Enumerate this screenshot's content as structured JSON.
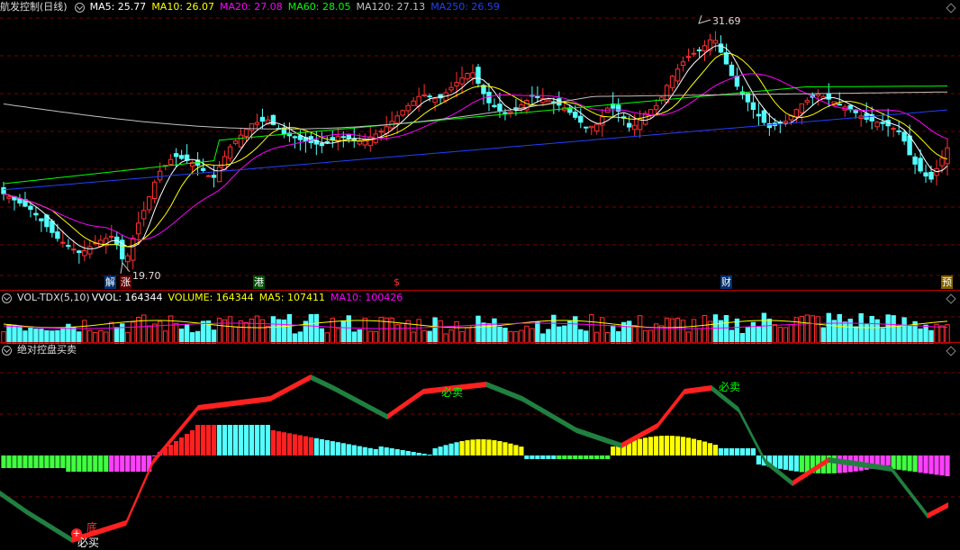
{
  "main_panel": {
    "title": "航发控制(日线)",
    "ma_labels": [
      {
        "text": "MA5: 25.77",
        "color": "#ffffff"
      },
      {
        "text": "MA10: 26.07",
        "color": "#ffff00"
      },
      {
        "text": "MA20: 27.08",
        "color": "#ff00ff"
      },
      {
        "text": "MA60: 28.05",
        "color": "#00ff00"
      },
      {
        "text": "MA120: 27.13",
        "color": "#c0c0c0"
      },
      {
        "text": "MA250: 26.59",
        "color": "#2040ff"
      }
    ],
    "high_label": "31.69",
    "low_label": "19.70",
    "event_marks": [
      {
        "text": "解",
        "bg": "#003070",
        "fg": "#ffffff"
      },
      {
        "text": "涨",
        "bg": "#5a0000",
        "fg": "#ffffff"
      },
      {
        "text": "港",
        "bg": "#005000",
        "fg": "#ffffff"
      },
      {
        "text": "$",
        "bg": "#000000",
        "fg": "#ff3030"
      },
      {
        "text": "财",
        "bg": "#003070",
        "fg": "#ffffff"
      },
      {
        "text": "预",
        "bg": "#806000",
        "fg": "#ffffff"
      }
    ]
  },
  "volume_panel": {
    "title": "VOL-TDX(5,10)",
    "labels": [
      {
        "text": "VVOL: 164344",
        "color": "#ffffff"
      },
      {
        "text": "VOLUME: 164344",
        "color": "#ffff00"
      },
      {
        "text": "MA5: 107411",
        "color": "#ffff00"
      },
      {
        "text": "MA10: 100426",
        "color": "#ff00ff"
      }
    ]
  },
  "indicator_panel": {
    "title": "绝对控盘买卖",
    "signals": [
      {
        "text": "必卖",
        "color": "#00ff00"
      },
      {
        "text": "必卖",
        "color": "#00ff00"
      },
      {
        "text": "底",
        "color": "#ff3030"
      },
      {
        "text": "必买",
        "color": "#ffffff"
      }
    ]
  },
  "colors": {
    "up": "#ff3030",
    "down": "#54ffff",
    "grid": "#8b0000",
    "separator": "#c00000"
  }
}
